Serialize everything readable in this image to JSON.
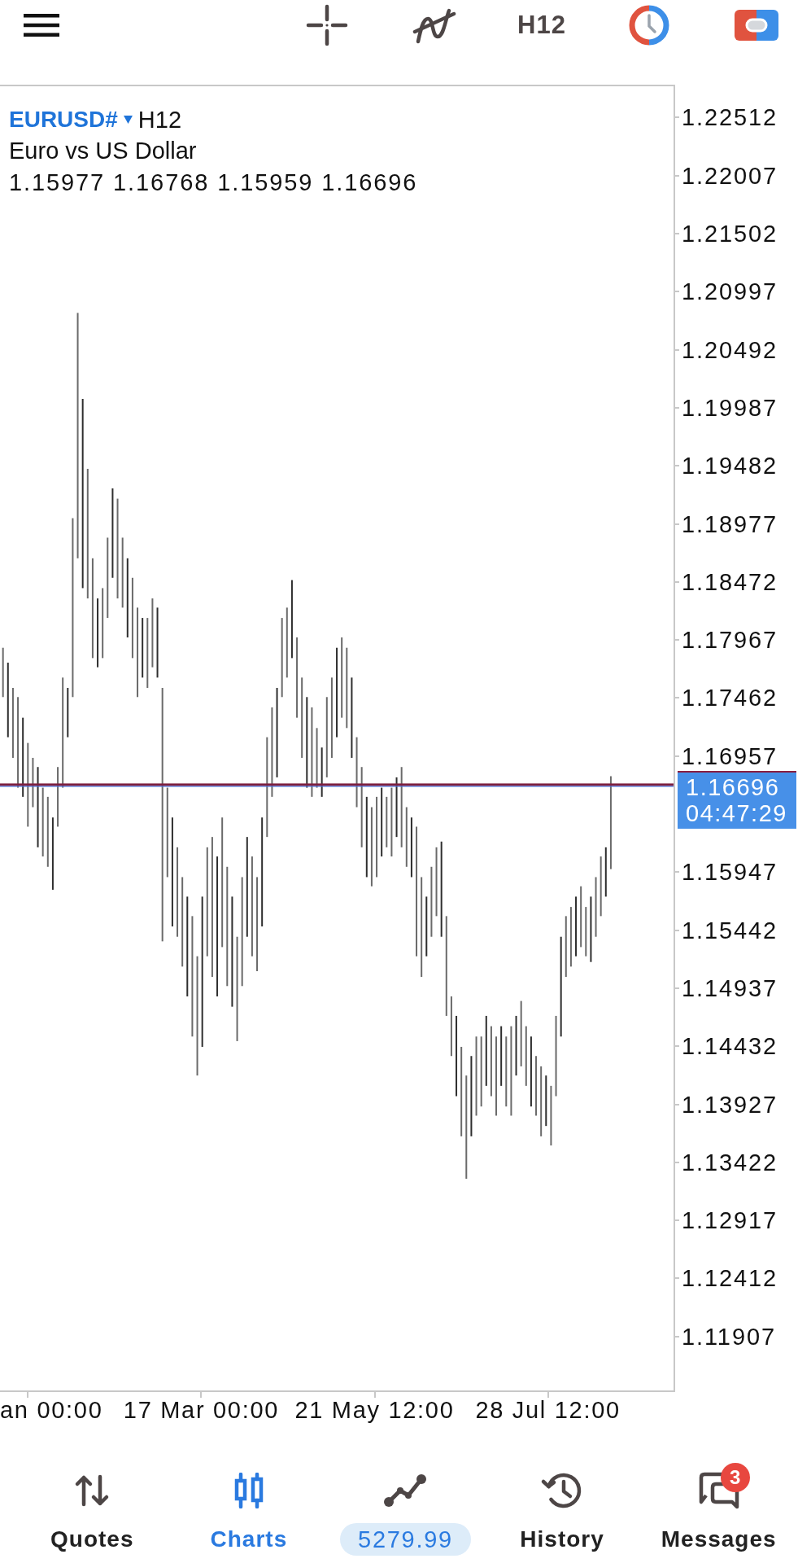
{
  "toolbar": {
    "timeframe": "H12"
  },
  "chart": {
    "symbol": "EURUSD#",
    "timeframe": "H12",
    "description": "Euro vs US Dollar",
    "ohlc": "1.15977 1.16768 1.15959 1.16696",
    "price_axis": [
      {
        "kind": "tick",
        "label": "1.22512"
      },
      {
        "kind": "tick",
        "label": "1.22007"
      },
      {
        "kind": "tick",
        "label": "1.21502"
      },
      {
        "kind": "tick",
        "label": "1.20997"
      },
      {
        "kind": "tick",
        "label": "1.20492"
      },
      {
        "kind": "tick",
        "label": "1.19987"
      },
      {
        "kind": "tick",
        "label": "1.19482"
      },
      {
        "kind": "tick",
        "label": "1.18977"
      },
      {
        "kind": "tick",
        "label": "1.18472"
      },
      {
        "kind": "tick",
        "label": "1.17967"
      },
      {
        "kind": "tick",
        "label": "1.17462"
      },
      {
        "kind": "tick",
        "label": "1.16957"
      },
      {
        "kind": "current",
        "price": "1.16696",
        "countdown": "04:47:29"
      },
      {
        "kind": "tick",
        "label": "1.15947"
      },
      {
        "kind": "tick",
        "label": "1.15442"
      },
      {
        "kind": "tick",
        "label": "1.14937"
      },
      {
        "kind": "tick",
        "label": "1.14432"
      },
      {
        "kind": "tick",
        "label": "1.13927"
      },
      {
        "kind": "tick",
        "label": "1.13422"
      },
      {
        "kind": "tick",
        "label": "1.12917"
      },
      {
        "kind": "tick",
        "label": "1.12412"
      },
      {
        "kind": "tick",
        "label": "1.11907"
      }
    ],
    "time_axis": [
      "an 00:00",
      "17 Mar 00:00",
      "21 May 12:00",
      "28 Jul 12:00"
    ]
  },
  "bottom_nav": [
    {
      "kind": "tab",
      "label": "Quotes",
      "selected": false
    },
    {
      "kind": "tab",
      "label": "Charts",
      "selected": true
    },
    {
      "kind": "balance",
      "label": "5279.99",
      "selected": false
    },
    {
      "kind": "tab",
      "label": "History",
      "selected": false
    },
    {
      "kind": "tab",
      "label": "Messages",
      "selected": false,
      "badge": "3"
    }
  ]
}
